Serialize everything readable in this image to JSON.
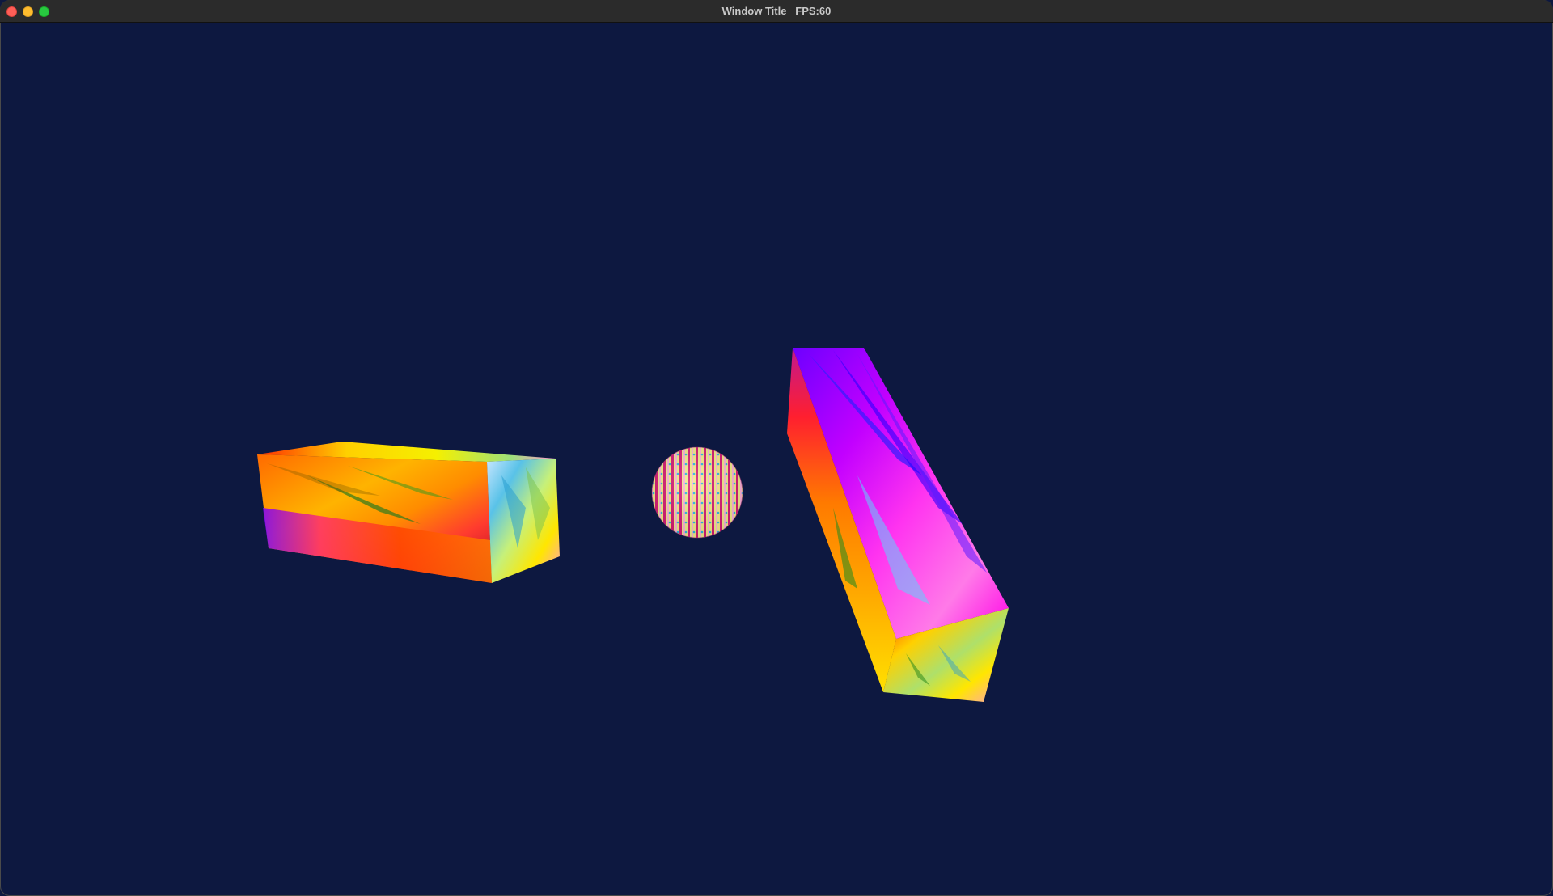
{
  "window": {
    "title": "Window Title   FPS:60",
    "background_color": "#0d1840"
  },
  "titlebar": {
    "buttons": [
      {
        "name": "close",
        "color": "#ff5f57"
      },
      {
        "name": "minimize",
        "color": "#febc2e"
      },
      {
        "name": "maximize",
        "color": "#28c840"
      }
    ]
  },
  "scene": {
    "objects": [
      {
        "name": "left-box",
        "shape": "cuboid",
        "material": "rainbow-gradient"
      },
      {
        "name": "center-sphere",
        "shape": "sphere",
        "material": "rainbow-striped"
      },
      {
        "name": "right-box",
        "shape": "cuboid",
        "material": "rainbow-gradient"
      }
    ]
  }
}
